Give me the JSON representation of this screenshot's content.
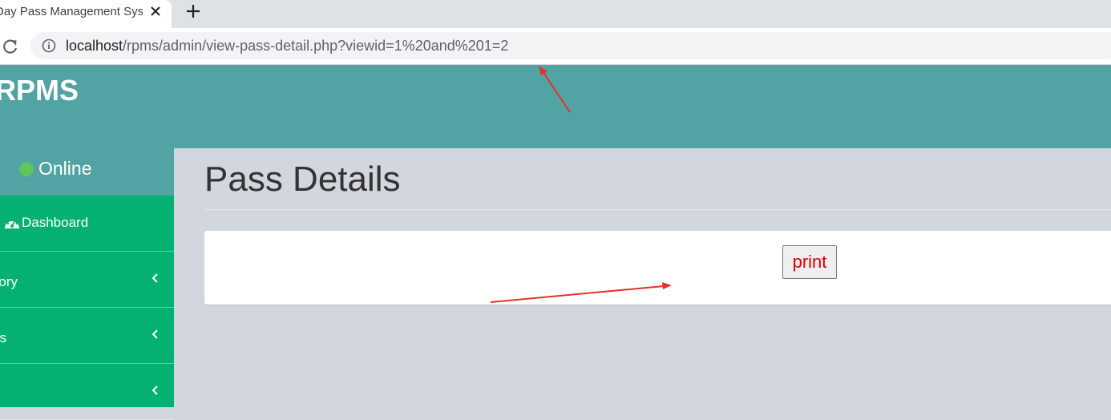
{
  "browser": {
    "tab_title": "Day Pass Management System",
    "new_tab_symbol": "+",
    "url_host": "localhost",
    "url_path": "/rpms/admin/view-pass-detail.php?viewid=1%20and%201=2"
  },
  "header": {
    "logo_text": "RPMS"
  },
  "sidebar": {
    "status_text": "Online",
    "items": [
      {
        "label": "Dashboard",
        "icon": "dashboard-icon"
      },
      {
        "label": "Category",
        "icon": "chevron-left-icon"
      },
      {
        "label": "Pass",
        "icon": "chevron-left-icon"
      },
      {
        "label": "",
        "icon": "chevron-left-icon"
      }
    ]
  },
  "main": {
    "page_title": "Pass Details",
    "print_label": "print"
  },
  "colors": {
    "header_bg": "#52a3a3",
    "sidebar_bg": "#04b173",
    "content_bg": "#d2d6de",
    "annotation_arrow": "#e8302a",
    "print_text": "#e00000"
  }
}
